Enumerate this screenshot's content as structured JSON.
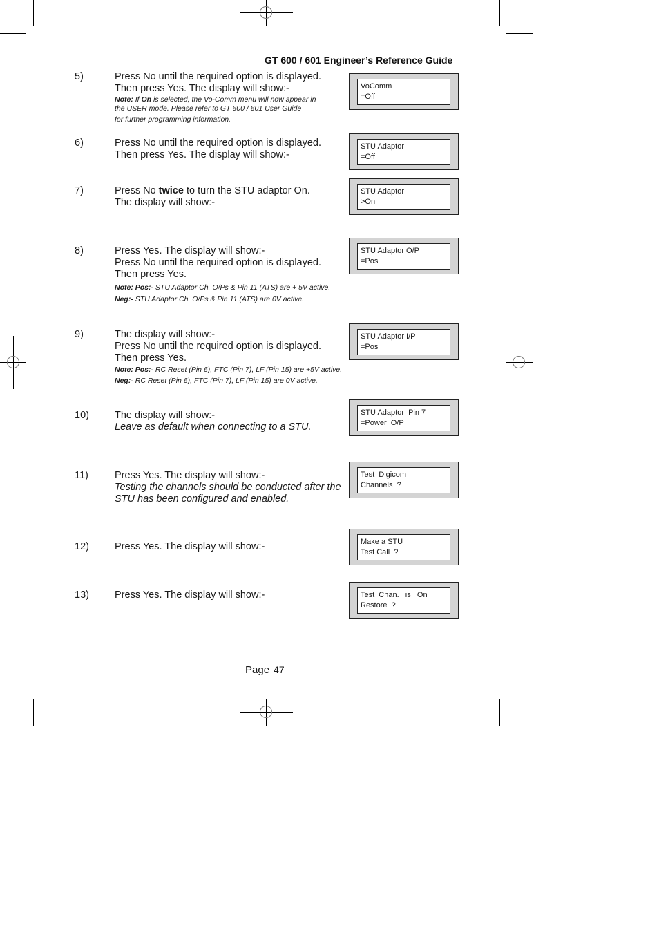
{
  "header": {
    "title": "GT 600 / 601 Engineer’s Reference Guide"
  },
  "steps": [
    {
      "number": "5)",
      "lines": [
        "Press No until the required option is displayed.",
        "Then press Yes. The display will show:-"
      ],
      "note": {
        "label": "Note:",
        "pre": " If ",
        "bold": "On",
        "post": " is selected, the Vo-Comm menu will now appear in",
        "line2": "the USER mode. Please refer to GT 600 / 601 User Guide",
        "line3": "for further programming information."
      },
      "display": {
        "line1": "VoComm",
        "line2": "=Off"
      }
    },
    {
      "number": "6)",
      "lines": [
        "Press No until the required option is displayed.",
        "Then press Yes. The display will show:-"
      ],
      "display": {
        "line1": "STU Adaptor",
        "line2": "=Off"
      }
    },
    {
      "number": "7)",
      "line1_pre": "Press No ",
      "line1_bold": "twice",
      "line1_post": " to turn the STU adaptor On.",
      "lines": [
        "The display will show:-"
      ],
      "display": {
        "line1": "STU Adaptor",
        "line2": ">On"
      }
    },
    {
      "number": "8)",
      "lines": [
        "Press Yes. The display will show:-",
        "Press No until the required option is displayed.",
        "Then press Yes."
      ],
      "note_pos": {
        "label": "Note: Pos:-",
        "text": " STU Adaptor Ch. O/Ps & Pin 11 (ATS) are + 5V active."
      },
      "note_neg": {
        "label": "Neg:-",
        "text": " STU Adaptor Ch. O/Ps & Pin 11 (ATS) are 0V active."
      },
      "display": {
        "line1": "STU Adaptor O/P",
        "line2": "=Pos"
      }
    },
    {
      "number": "9)",
      "lines": [
        "The display will show:-",
        "Press No until the required option is displayed.",
        "Then press Yes."
      ],
      "note_pos": {
        "label": "Note: Pos:-",
        "text": " RC Reset (Pin 6), FTC (Pin 7), LF (Pin 15) are +5V active."
      },
      "note_neg": {
        "label": "Neg:-",
        "text": " RC Reset (Pin 6), FTC (Pin 7), LF (Pin 15) are 0V active."
      },
      "display": {
        "line1": "STU Adaptor I/P",
        "line2": "=Pos"
      }
    },
    {
      "number": "10)",
      "lines": [
        "The display will show:-"
      ],
      "italic_lines": [
        "Leave as default when connecting to a STU."
      ],
      "display": {
        "line1": "STU Adaptor  Pin 7",
        "line2": "=Power  O/P"
      }
    },
    {
      "number": "11)",
      "lines": [
        "Press Yes. The display will show:-"
      ],
      "italic_lines": [
        "Testing the channels should be conducted after the",
        "STU has been configured and enabled."
      ],
      "display": {
        "line1": "Test  Digicom",
        "line2": "Channels  ?"
      }
    },
    {
      "number": "12)",
      "lines": [
        "Press Yes. The display will show:-"
      ],
      "display": {
        "line1": "Make a STU",
        "line2": "Test Call  ?"
      }
    },
    {
      "number": "13)",
      "lines": [
        "Press Yes. The display will show:-"
      ],
      "display": {
        "line1": "Test  Chan.   is   On",
        "line2": "Restore  ?"
      }
    }
  ],
  "footer": {
    "label": "Page",
    "number": "47"
  }
}
